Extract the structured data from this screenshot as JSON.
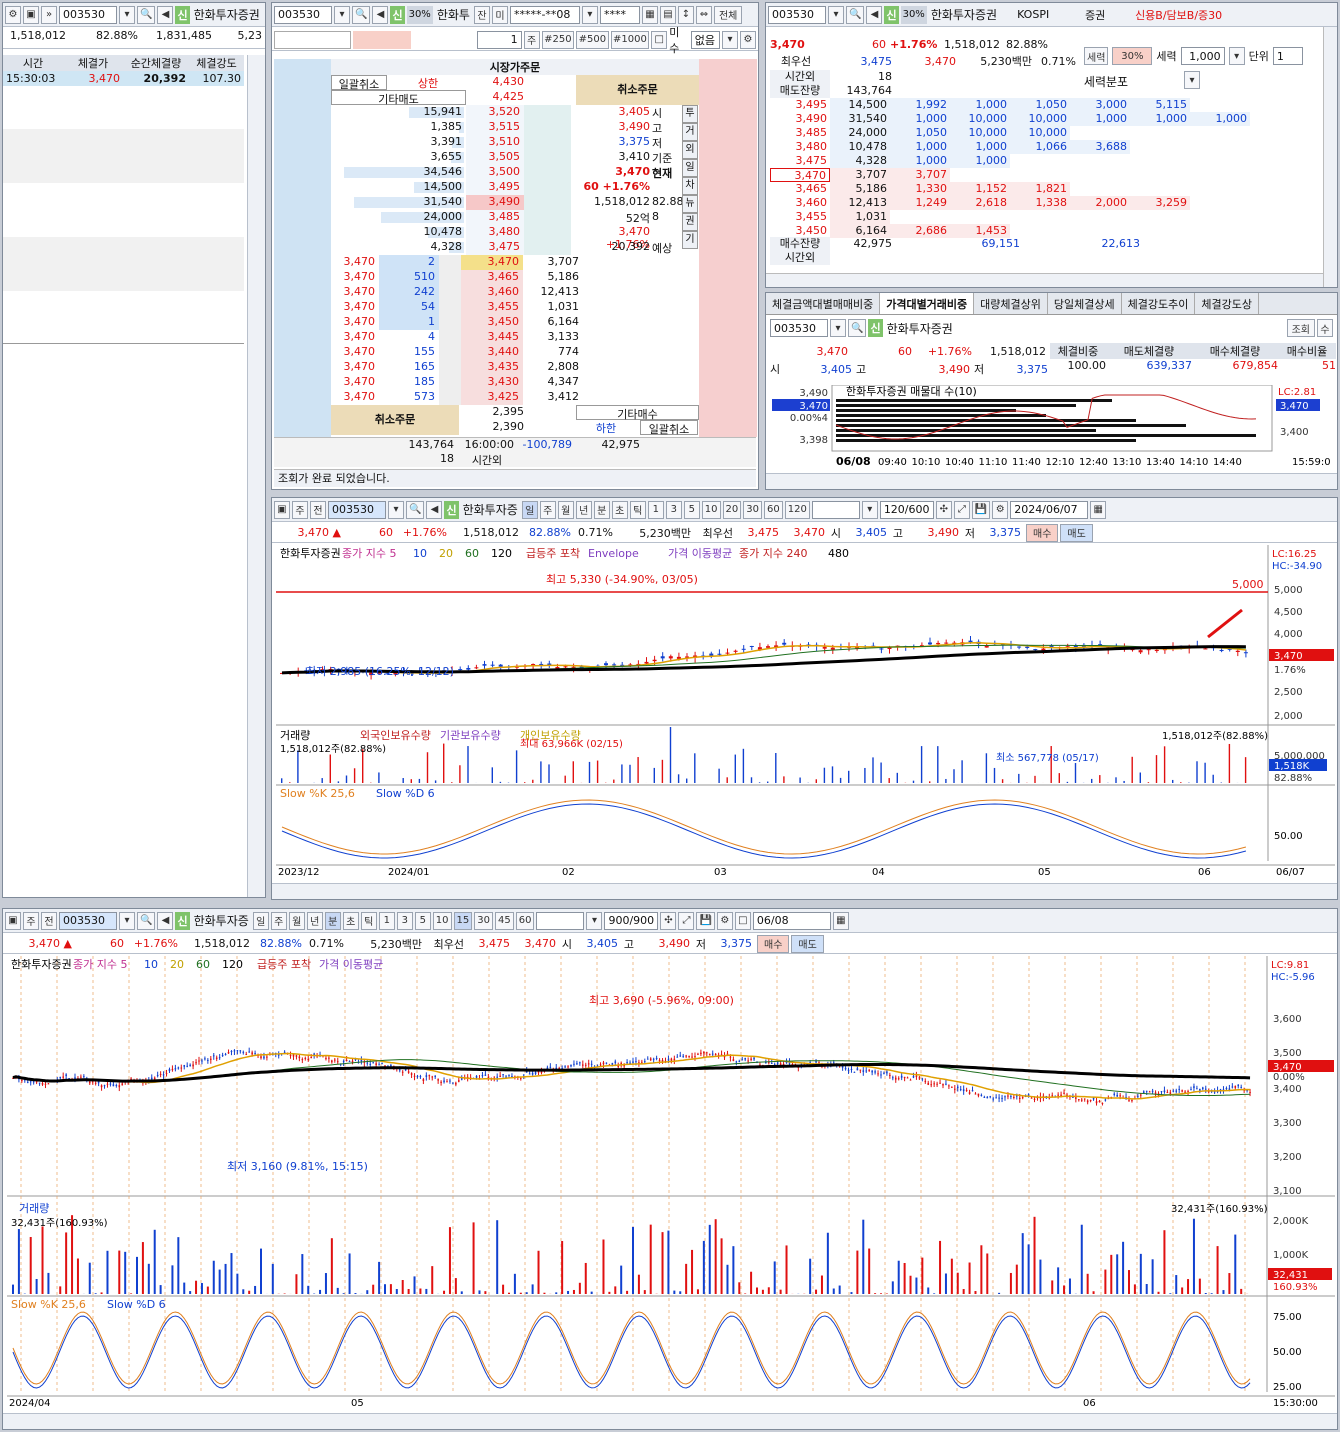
{
  "tick_panel": {
    "code": "003530",
    "name": "한화투자증권",
    "volume": "1,518,012",
    "pct": "82.88%",
    "prev_volume": "1,831,485",
    "amount": "5,23",
    "headers": [
      "시간",
      "체결가",
      "순간체결량",
      "체결강도"
    ],
    "row": {
      "time": "15:30:03",
      "price": "3,470",
      "qty": "20,392",
      "strength": "107.30"
    }
  },
  "order_panel": {
    "code": "003530",
    "name": "한화투",
    "p30": "30%",
    "acct": "*****-**08",
    "pw": "****",
    "all": "전체",
    "qty": "1",
    "unit": "주",
    "q250": "#250",
    "q500": "#500",
    "q1000": "#1000",
    "nomisu": "미수",
    "none": "없음",
    "title": "시장가주문",
    "cancel_all": "일괄취소",
    "upper": "상한",
    "upper_price": "4,430",
    "other_sell": "기타매도",
    "r2": "4,425",
    "cancel_order": "취소주문",
    "asks": [
      [
        "15,941",
        "3,520"
      ],
      [
        "1,385",
        "3,515"
      ],
      [
        "3,391",
        "3,510"
      ],
      [
        "3,655",
        "3,505"
      ],
      [
        "34,546",
        "3,500"
      ],
      [
        "14,500",
        "3,495"
      ],
      [
        "31,540",
        "3,490"
      ],
      [
        "24,000",
        "3,485"
      ],
      [
        "10,478",
        "3,480"
      ],
      [
        "4,328",
        "3,475"
      ]
    ],
    "bids": [
      [
        "3,470",
        "2",
        "3,470",
        "3,707"
      ],
      [
        "3,470",
        "510",
        "3,465",
        "5,186"
      ],
      [
        "3,470",
        "242",
        "3,460",
        "12,413"
      ],
      [
        "3,470",
        "54",
        "3,455",
        "1,031"
      ],
      [
        "3,470",
        "1",
        "3,450",
        "6,164"
      ],
      [
        "3,470",
        "4",
        "3,445",
        "3,133"
      ],
      [
        "3,470",
        "155",
        "3,440",
        "774"
      ],
      [
        "3,470",
        "165",
        "3,435",
        "2,808"
      ],
      [
        "3,470",
        "185",
        "3,430",
        "4,347"
      ],
      [
        "3,470",
        "573",
        "3,425",
        "3,412"
      ]
    ],
    "info": [
      [
        "3,405",
        "시"
      ],
      [
        "3,490",
        "고"
      ],
      [
        "3,375",
        "저"
      ],
      [
        "3,410",
        "기준"
      ],
      [
        "3,470",
        "현재"
      ],
      [
        "60 +1.76%",
        ""
      ],
      [
        "1,518,012",
        "82.88%"
      ],
      [
        "52억",
        "8"
      ],
      [
        "3,470 +1.76%",
        ""
      ],
      [
        "20,392",
        "예상"
      ]
    ],
    "side_tabs": [
      "투",
      "거",
      "외",
      "일",
      "차",
      "뉴",
      "권",
      "기"
    ],
    "low_r1": "2,395",
    "low_r2": "2,390",
    "other_buy": "기타매수",
    "lower": "하한",
    "cancel_all2": "일괄취소",
    "totals": [
      "143,764",
      "16:00:00",
      "-100,789",
      "42,975"
    ],
    "afterhours": [
      "18",
      "시간외"
    ],
    "status": "조회가 완료 되었습니다."
  },
  "depth_panel": {
    "code": "003530",
    "name": "한화투자증권",
    "market": "KOSPI",
    "sector": "증권",
    "credit": "신용B/담보B/증30",
    "price": "3,470",
    "change": "60",
    "rate": "+1.76%",
    "volume": "1,518,012",
    "pct": "82.88%",
    "best_label": "최우선",
    "best_ask": "3,475",
    "best_bid": "3,470",
    "amount": "5,230백만",
    "ratio": "0.71%",
    "force": "세력",
    "p30": "30%",
    "force2": "세력",
    "qty": "1,000",
    "unit_label": "단위",
    "unit": "1",
    "after_label": "시간외",
    "after_val": "18",
    "remain_label": "매도잔량",
    "remain_val": "143,764",
    "dist_title": "세력분포",
    "rows": [
      [
        "3,495",
        "14,500",
        "1,992",
        "1,000",
        "1,050",
        "3,000",
        "5,115",
        ""
      ],
      [
        "3,490",
        "31,540",
        "1,000",
        "10,000",
        "10,000",
        "1,000",
        "1,000",
        "1,000"
      ],
      [
        "3,485",
        "24,000",
        "1,050",
        "10,000",
        "10,000",
        "",
        "",
        ""
      ],
      [
        "3,480",
        "10,478",
        "1,000",
        "1,000",
        "1,066",
        "3,688",
        "",
        ""
      ],
      [
        "3,475",
        "4,328",
        "1,000",
        "1,000",
        "",
        "",
        "",
        ""
      ],
      [
        "3,470",
        "3,707",
        "3,707",
        "",
        "",
        "",
        "",
        ""
      ],
      [
        "3,465",
        "5,186",
        "1,330",
        "1,152",
        "1,821",
        "",
        "",
        ""
      ],
      [
        "3,460",
        "12,413",
        "1,249",
        "2,618",
        "1,338",
        "2,000",
        "3,259",
        ""
      ],
      [
        "3,455",
        "1,031",
        "",
        "",
        "",
        "",
        "",
        ""
      ],
      [
        "3,450",
        "6,164",
        "2,686",
        "1,453",
        "",
        "",
        "",
        ""
      ]
    ],
    "buy_remain_label": "매수잔량",
    "buy_remain": "42,975",
    "buy_sum1": "69,151",
    "buy_sum2": "22,613",
    "time_label": "시간외"
  },
  "trade_panel": {
    "tabs": [
      "체결금액대별매매비중",
      "가격대별거래비중",
      "대량체결상위",
      "당일체결상세",
      "체결강도추이",
      "체결강도상"
    ],
    "code": "003530",
    "name": "한화투자증권",
    "query": "조회",
    "price": "3,470",
    "change": "60",
    "rate": "+1.76%",
    "volume": "1,518,012",
    "cols": [
      "체결비중",
      "매도체결량",
      "매수체결량",
      "매수비율"
    ],
    "vals": [
      "100.00",
      "639,337",
      "679,854",
      "51"
    ],
    "open": "3,405",
    "high": "3,490",
    "low": "3,375",
    "chart_title": "한화투자증권 매물대 수(10)",
    "date": "06/08",
    "times": [
      "09:40",
      "10:10",
      "10:40",
      "11:10",
      "11:40",
      "12:10",
      "12:40",
      "13:10",
      "13:40",
      "14:10",
      "14:40"
    ],
    "end": "15:59:0",
    "lc": "LC:2.81",
    "y": [
      "3,490",
      "3,470",
      "0.00%4",
      "3,398"
    ],
    "yr": [
      "3,470",
      "3,400"
    ]
  },
  "daily_chart": {
    "code": "003530",
    "period": "120/600",
    "date": "2024/06/07",
    "tabs": [
      "일",
      "주",
      "월",
      "년",
      "분",
      "초",
      "틱"
    ],
    "mins": [
      "1",
      "3",
      "5",
      "10",
      "20",
      "30",
      "60",
      "120"
    ],
    "info": {
      "price": "3,470",
      "change": "60",
      "rate": "+1.76%",
      "volume": "1,518,012",
      "pct": "82.88%",
      "ratio": "0.71%",
      "amount": "5,230백만",
      "best": "최우선",
      "ask": "3,475",
      "bid": "3,470",
      "open": "3,405",
      "high": "3,490",
      "low": "3,375",
      "buy": "매수",
      "sell": "매도"
    },
    "legend": [
      "한화투자증권",
      "종가 지수 5",
      "10",
      "20",
      "60",
      "120",
      "급등주 포착",
      "Envelope",
      "가격 이동평균",
      "종가 지수 240",
      "480"
    ],
    "annot_high": "최고 5,330 (-34.90%, 03/05)",
    "annot_low": "최저 2,985 (16.25%, 12/12)",
    "level": "5,000",
    "lc": "LC:16.25",
    "hc": "HC:-34.90",
    "yaxis": [
      "5,000",
      "4,500",
      "4,000",
      "3,470",
      "1.76%",
      "2,500",
      "2,000"
    ],
    "vol_legend": [
      "거래량",
      "외국인보유수량",
      "기관보유수량",
      "개인보유수량"
    ],
    "vol_left": "1,518,012주(82.88%)",
    "vol_right": "1,518,012주(82.88%)",
    "vol_max": "최대 63,966K (02/15)",
    "vol_min": "최소 567,778 (05/17)",
    "vol_y": [
      "5,000,000",
      "1,518K",
      "82.88%"
    ],
    "stoch_legend": [
      "Slow %K 25,6",
      "Slow %D 6"
    ],
    "stoch_y": "50.00",
    "xaxis": [
      "2023/12",
      "2024/01",
      "02",
      "03",
      "04",
      "05",
      "06",
      "06/07"
    ]
  },
  "minute_chart": {
    "code": "003530",
    "period": "900/900",
    "date": "06/08",
    "tabs": [
      "일",
      "주",
      "월",
      "년",
      "분",
      "초",
      "틱"
    ],
    "mins": [
      "1",
      "3",
      "5",
      "10",
      "15",
      "30",
      "45",
      "60"
    ],
    "sel": "15",
    "info": {
      "price": "3,470",
      "change": "60",
      "rate": "+1.76%",
      "volume": "1,518,012",
      "pct": "82.88%",
      "ratio": "0.71%",
      "amount": "5,230백만",
      "best": "최우선",
      "ask": "3,475",
      "bid": "3,470",
      "open": "3,405",
      "high": "3,490",
      "low": "3,375",
      "buy": "매수",
      "sell": "매도"
    },
    "legend": [
      "한화투자증권",
      "종가 지수 5",
      "10",
      "20",
      "60",
      "120",
      "급등주 포착",
      "가격 이동평균"
    ],
    "annot_high": "최고 3,690 (-5.96%, 09:00)",
    "annot_low": "최저 3,160 (9.81%, 15:15)",
    "lc": "LC:9.81",
    "hc": "HC:-5.96",
    "yaxis": [
      "3,600",
      "3,500",
      "3,470",
      "0.00%",
      "3,400",
      "3,300",
      "3,200",
      "3,100"
    ],
    "vol_title": "거래량",
    "vol_left": "32,431주(160.93%)",
    "vol_right": "32,431주(160.93%)",
    "vol_y": [
      "2,000K",
      "1,000K",
      "32,431",
      "160.93%"
    ],
    "stoch_legend": [
      "Slow %K 25,6",
      "Slow %D 6"
    ],
    "stoch_y": [
      "75.00",
      "50.00",
      "25.00"
    ],
    "xaxis": [
      "2024/04",
      "05",
      "06",
      "15:30:00"
    ]
  }
}
